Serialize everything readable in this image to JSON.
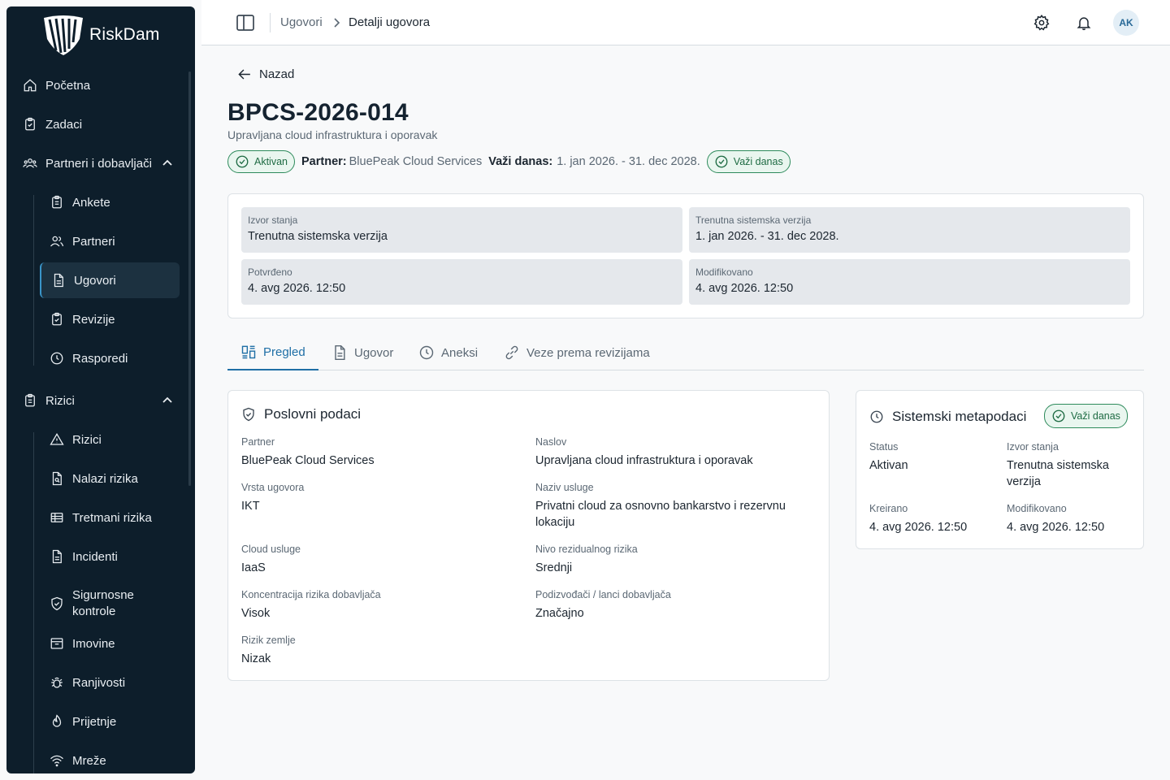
{
  "app": {
    "name": "RiskDam"
  },
  "sidebar": {
    "items": [
      {
        "label": "Početna"
      },
      {
        "label": "Zadaci"
      },
      {
        "label": "Partneri i dobavljači"
      },
      {
        "label": "Ankete"
      },
      {
        "label": "Partneri"
      },
      {
        "label": "Ugovori"
      },
      {
        "label": "Revizije"
      },
      {
        "label": "Rasporedi"
      },
      {
        "label": "Rizici"
      },
      {
        "label": "Rizici"
      },
      {
        "label": "Nalazi rizika"
      },
      {
        "label": "Tretmani rizika"
      },
      {
        "label": "Incidenti"
      },
      {
        "label": "Sigurnosne kontrole"
      },
      {
        "label": "Imovine"
      },
      {
        "label": "Ranjivosti"
      },
      {
        "label": "Prijetnje"
      },
      {
        "label": "Mreže"
      }
    ]
  },
  "header": {
    "breadcrumb": [
      "Ugovori",
      "Detalji ugovora"
    ],
    "user_initials": "AK"
  },
  "page": {
    "back_label": "Nazad",
    "title": "BPCS-2026-014",
    "subtitle": "Upravljana cloud infrastruktura i oporavak",
    "status_badge": "Aktivan",
    "partner_label": "Partner:",
    "partner_value": "BluePeak Cloud Services",
    "valid_label": "Važi danas:",
    "valid_value": "1. jan 2026. - 31. dec 2028.",
    "valid_badge": "Važi danas"
  },
  "state": {
    "cells": [
      {
        "key": "Izvor stanja",
        "value": "Trenutna sistemska verzija"
      },
      {
        "key": "Trenutna sistemska verzija",
        "value": "1. jan 2026. - 31. dec 2028."
      },
      {
        "key": "Potvrđeno",
        "value": "4. avg 2026. 12:50"
      },
      {
        "key": "Modifikovano",
        "value": "4. avg 2026. 12:50"
      }
    ]
  },
  "tabs": [
    {
      "label": "Pregled"
    },
    {
      "label": "Ugovor"
    },
    {
      "label": "Aneksi"
    },
    {
      "label": "Veze prema revizijama"
    }
  ],
  "business": {
    "title": "Poslovni podaci",
    "fields": [
      {
        "key": "Partner",
        "value": "BluePeak Cloud Services"
      },
      {
        "key": "Naslov",
        "value": "Upravljana cloud infrastruktura i oporavak"
      },
      {
        "key": "Vrsta ugovora",
        "value": "IKT"
      },
      {
        "key": "Naziv usluge",
        "value": "Privatni cloud za osnovno bankarstvo i rezervnu lokaciju"
      },
      {
        "key": "Cloud usluge",
        "value": "IaaS"
      },
      {
        "key": "Nivo rezidualnog rizika",
        "value": "Srednji"
      },
      {
        "key": "Koncentracija rizika dobavljača",
        "value": "Visok"
      },
      {
        "key": "Podizvođači / lanci dobavljača",
        "value": "Značajno"
      },
      {
        "key": "Rizik zemlje",
        "value": "Nizak"
      }
    ]
  },
  "system": {
    "title": "Sistemski metapodaci",
    "badge": "Važi danas",
    "fields": [
      {
        "key": "Status",
        "value": "Aktivan"
      },
      {
        "key": "Izvor stanja",
        "value": "Trenutna sistemska verzija"
      },
      {
        "key": "Kreirano",
        "value": "4. avg 2026. 12:50"
      },
      {
        "key": "Modifikovano",
        "value": "4. avg 2026. 12:50"
      }
    ]
  },
  "colors": {
    "sidebar": "#0d1e2b",
    "accent": "#1f6fa6",
    "success": "#2e8b5c"
  }
}
